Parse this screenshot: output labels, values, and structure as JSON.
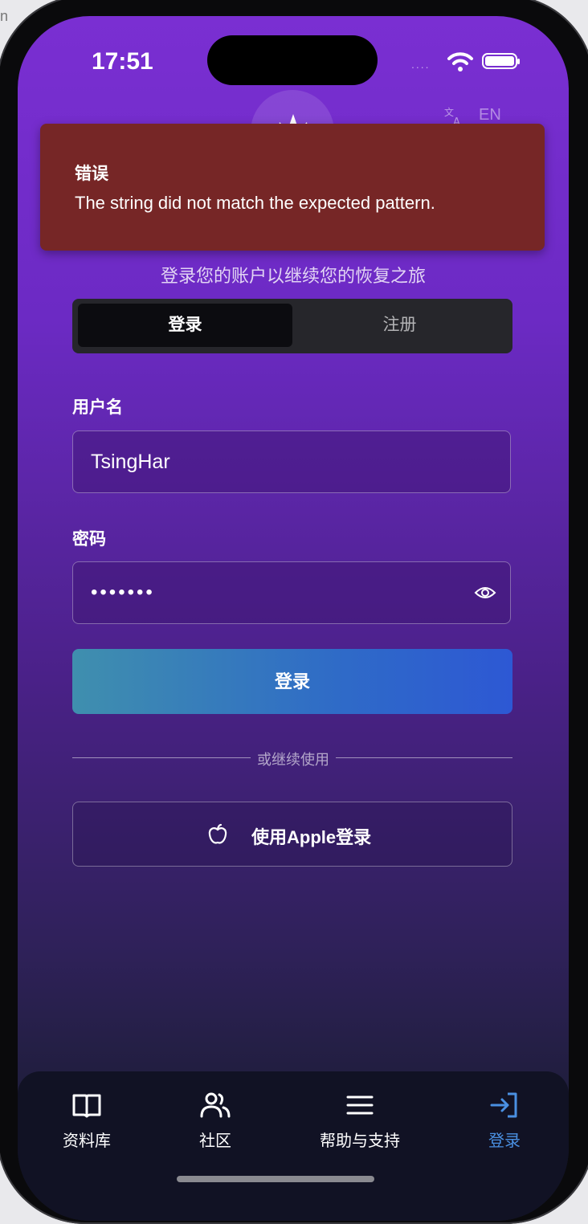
{
  "corner_mark": "n",
  "status_bar": {
    "time": "17:51",
    "signal": "...."
  },
  "header": {
    "language": "EN"
  },
  "error": {
    "title": "错误",
    "message": "The string did not match the expected pattern."
  },
  "subtitle": "登录您的账户以继续您的恢复之旅",
  "segmented": {
    "login": "登录",
    "register": "注册"
  },
  "form": {
    "username_label": "用户名",
    "username_value": "TsingHar",
    "password_label": "密码",
    "password_value": "•••••••",
    "submit_label": "登录"
  },
  "divider": "或继续使用",
  "apple_label": "使用Apple登录",
  "tabs": [
    {
      "label": "资料库",
      "icon": "book-icon"
    },
    {
      "label": "社区",
      "icon": "users-icon"
    },
    {
      "label": "帮助与支持",
      "icon": "menu-icon"
    },
    {
      "label": "登录",
      "icon": "login-icon",
      "active": true
    }
  ],
  "colors": {
    "accent": "#4a90e2",
    "error": "#762626"
  }
}
